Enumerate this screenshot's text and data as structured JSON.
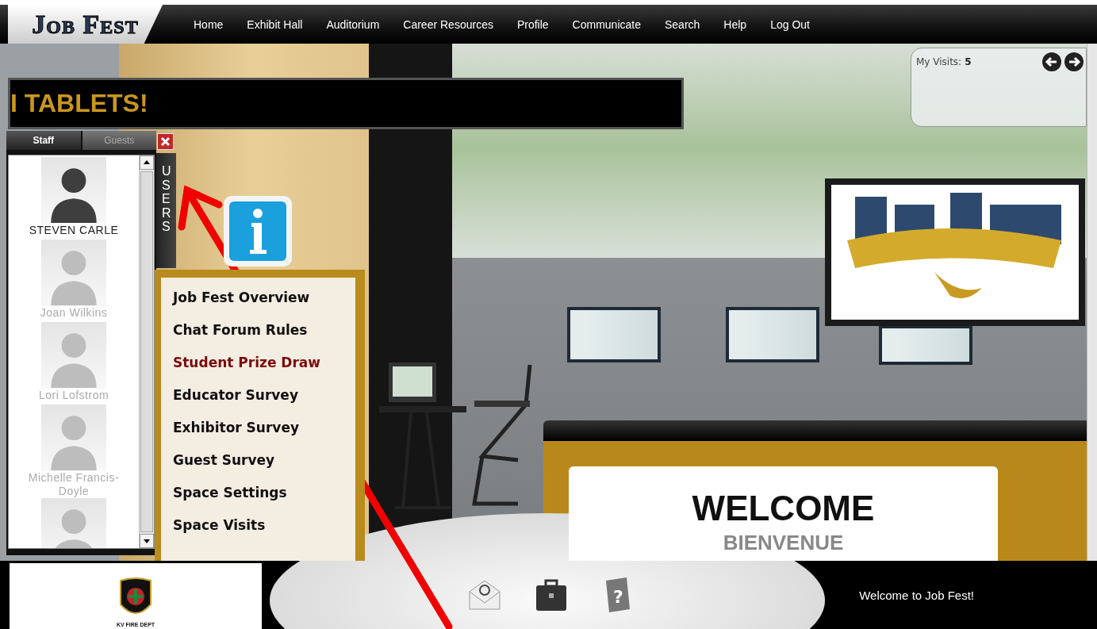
{
  "nav": {
    "logo": "Job Fest",
    "items": [
      {
        "label": "Home"
      },
      {
        "label": "Exhibit Hall"
      },
      {
        "label": "Auditorium"
      },
      {
        "label": "Career Resources"
      },
      {
        "label": "Profile"
      },
      {
        "label": "Communicate"
      },
      {
        "label": "Search"
      },
      {
        "label": "Help"
      },
      {
        "label": "Log Out"
      }
    ]
  },
  "ticker": {
    "text": "I TABLETS!"
  },
  "users_panel": {
    "tabs": [
      {
        "label": "Staff",
        "selected": true
      },
      {
        "label": "Guests",
        "selected": false
      }
    ],
    "side_tab": "USERS",
    "users": [
      {
        "name": "STEVEN CARLE",
        "online": true
      },
      {
        "name": "Joan Wilkins",
        "online": false
      },
      {
        "name": "Lori Lofstrom",
        "online": false
      },
      {
        "name": "Michelle Francis-Doyle",
        "online": false
      },
      {
        "online": false
      }
    ]
  },
  "info_menu": {
    "items": [
      {
        "label": "Job Fest Overview",
        "color": "#111111"
      },
      {
        "label": "Chat Forum Rules",
        "color": "#111111"
      },
      {
        "label": "Student Prize Draw",
        "color": "#7a0c0c"
      },
      {
        "label": "Educator Survey",
        "color": "#111111"
      },
      {
        "label": "Exhibitor Survey",
        "color": "#111111"
      },
      {
        "label": "Guest Survey",
        "color": "#111111"
      },
      {
        "label": "Space Settings",
        "color": "#111111"
      },
      {
        "label": "Space Visits",
        "color": "#111111"
      }
    ]
  },
  "visits": {
    "label": "My Visits:",
    "count": "5"
  },
  "desk_sign": {
    "title": "WELCOME",
    "subtitle": "BIENVENUE"
  },
  "footer": {
    "sponsor_caption": "KV FIRE DEPT",
    "help_glyph": "?",
    "message": "Welcome to Job Fest!"
  }
}
